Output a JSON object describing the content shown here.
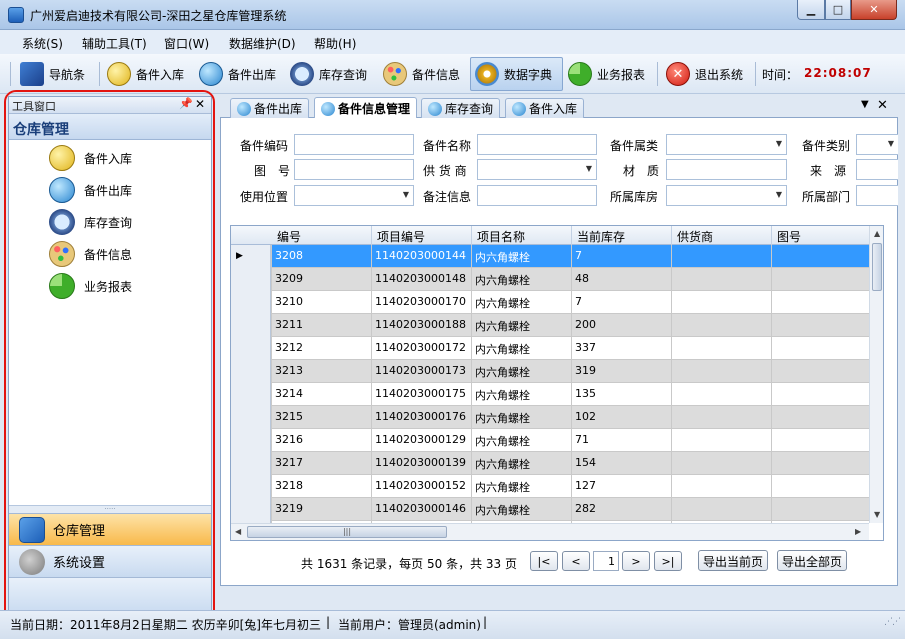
{
  "window": {
    "title": "广州爱启迪技术有限公司-深田之星仓库管理系统",
    "controls": [
      "minimize",
      "maximize",
      "close"
    ]
  },
  "menu": [
    "系统(S)",
    "辅助工具(T)",
    "窗口(W)",
    "数据维护(D)",
    "帮助(H)"
  ],
  "toolbar": {
    "buttons": [
      {
        "label": "导航条",
        "icon": "navigation-icon"
      },
      {
        "label": "备件入库",
        "icon": "stock-in-icon"
      },
      {
        "label": "备件出库",
        "icon": "stock-out-icon"
      },
      {
        "label": "库存查询",
        "icon": "search-icon"
      },
      {
        "label": "备件信息",
        "icon": "palette-icon"
      },
      {
        "label": "数据字典",
        "icon": "gears-icon",
        "active": true
      },
      {
        "label": "业务报表",
        "icon": "pie-chart-icon"
      },
      {
        "label": "退出系统",
        "icon": "exit-icon"
      }
    ],
    "time_label": "时间：",
    "time_value": "22:08:07"
  },
  "left_panel": {
    "header": "工具窗口",
    "section_title": "仓库管理",
    "items": [
      "备件入库",
      "备件出库",
      "库存查询",
      "备件信息",
      "业务报表"
    ],
    "nav_panes": [
      "仓库管理",
      "系统设置"
    ]
  },
  "tabs": [
    {
      "label": "备件出库"
    },
    {
      "label": "备件信息管理",
      "selected": true
    },
    {
      "label": "库存查询"
    },
    {
      "label": "备件入库"
    }
  ],
  "filters": {
    "part_code_label": "备件编码",
    "part_code_value": "",
    "part_name_label": "备件名称",
    "part_category_label": "备件属类",
    "part_type_label": "备件类别",
    "drawing_no_label": "图　号",
    "supplier_label": "供 货 商",
    "material_label": "材　质",
    "source_label": "来　源",
    "use_location_label": "使用位置",
    "remark_label": "备注信息",
    "warehouse_label": "所属库房",
    "department_label": "所属部门"
  },
  "grid": {
    "columns": [
      "编号",
      "项目编号",
      "项目名称",
      "当前库存",
      "供货商",
      "图号"
    ],
    "rows": [
      [
        "3208",
        "1140203000144",
        "内六角螺栓",
        "7",
        "",
        ""
      ],
      [
        "3209",
        "1140203000148",
        "内六角螺栓",
        "48",
        "",
        ""
      ],
      [
        "3210",
        "1140203000170",
        "内六角螺栓",
        "7",
        "",
        ""
      ],
      [
        "3211",
        "1140203000188",
        "内六角螺栓",
        "200",
        "",
        ""
      ],
      [
        "3212",
        "1140203000172",
        "内六角螺栓",
        "337",
        "",
        ""
      ],
      [
        "3213",
        "1140203000173",
        "内六角螺栓",
        "319",
        "",
        ""
      ],
      [
        "3214",
        "1140203000175",
        "内六角螺栓",
        "135",
        "",
        ""
      ],
      [
        "3215",
        "1140203000176",
        "内六角螺栓",
        "102",
        "",
        ""
      ],
      [
        "3216",
        "1140203000129",
        "内六角螺栓",
        "71",
        "",
        ""
      ],
      [
        "3217",
        "1140203000139",
        "内六角螺栓",
        "154",
        "",
        ""
      ],
      [
        "3218",
        "1140203000152",
        "内六角螺栓",
        "127",
        "",
        ""
      ],
      [
        "3219",
        "1140203000146",
        "内六角螺栓",
        "282",
        "",
        ""
      ]
    ],
    "selected_row": 0
  },
  "pager": {
    "summary": "共 1631 条记录，每页 50 条，共 33 页",
    "first": "|<",
    "prev": "<",
    "current_page": "1",
    "next": ">",
    "last": ">|",
    "export_current": "导出当前页",
    "export_all": "导出全部页"
  },
  "status": {
    "date": "当前日期：2011年8月2日星期二 农历辛卯[兔]年七月初三",
    "separator": "|",
    "user": "当前用户：管理员(admin)"
  },
  "colors": {
    "selection": "#3399ff",
    "alt_row": "#dcdcdc",
    "clock": "#c00000",
    "annotation": "#e3140f",
    "nav_active": "#f8b94b"
  }
}
